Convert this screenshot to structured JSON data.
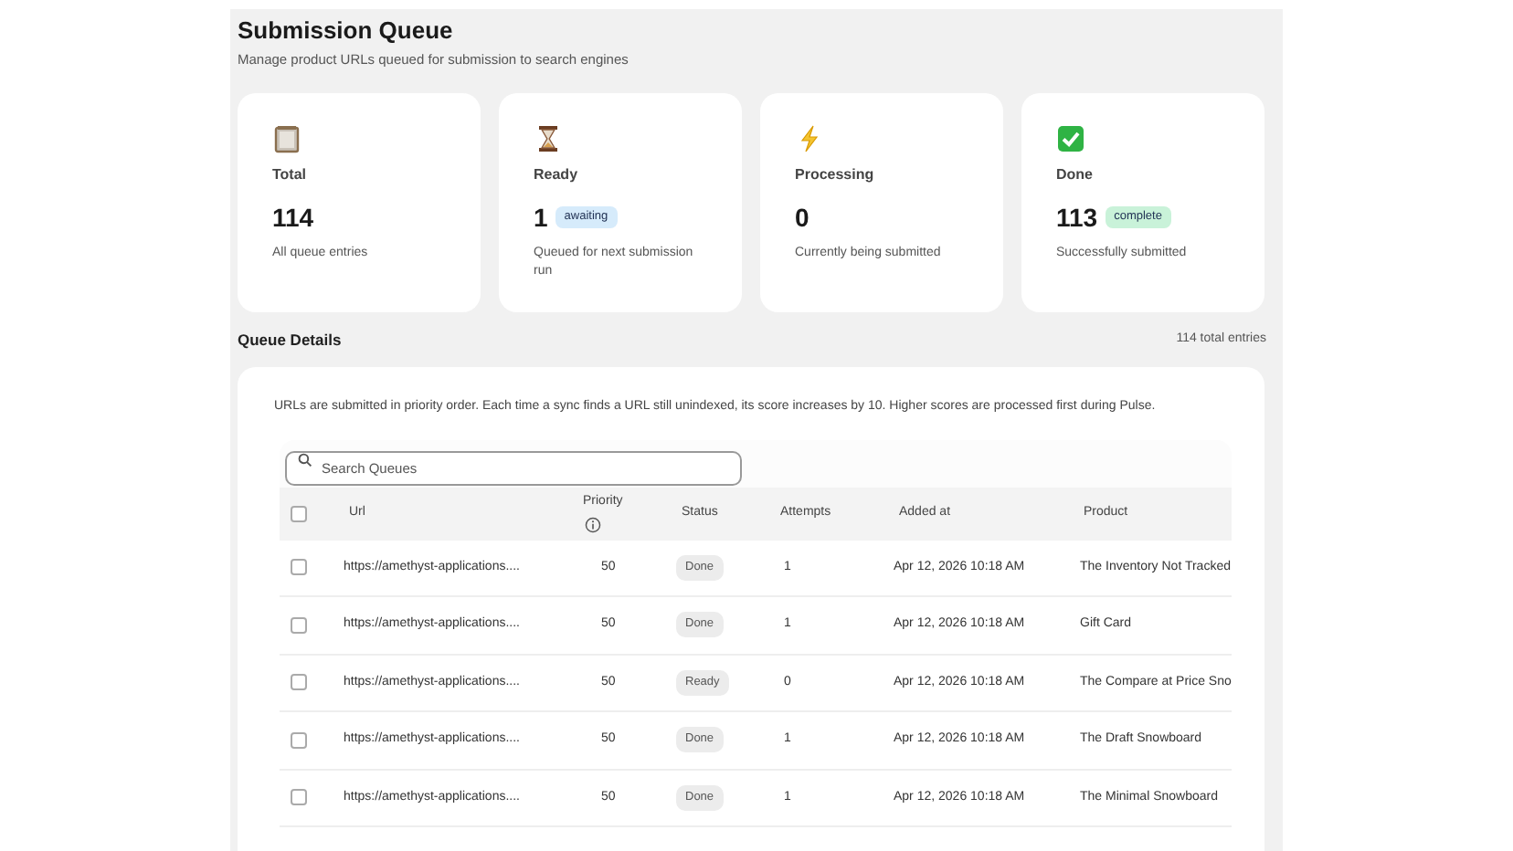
{
  "header": {
    "title": "Submission Queue",
    "subtitle": "Manage product URLs queued for submission to search engines"
  },
  "stats": [
    {
      "kind": "clipboard",
      "label": "Total",
      "value": "114",
      "description": "All queue entries"
    },
    {
      "kind": "hourglass",
      "label": "Ready",
      "value": "1",
      "badge": {
        "text": "awaiting",
        "color": "#d6ebfb"
      },
      "description": "Queued for next submission run"
    },
    {
      "kind": "bolt",
      "label": "Processing",
      "value": "0",
      "description": "Currently being submitted"
    },
    {
      "kind": "check",
      "label": "Done",
      "value": "113",
      "badge": {
        "text": "complete",
        "color": "#c9f2d9"
      },
      "description": "Successfully submitted"
    }
  ],
  "details": {
    "title": "Queue Details",
    "count": "114 total entries",
    "note": "URLs are submitted in priority order. Each time a sync finds a URL still unindexed, its score increases by 10. Higher scores are processed first during Pulse.",
    "search": {
      "placeholder": "Search Queues"
    }
  },
  "table": {
    "select_all": {
      "checked": false
    },
    "columns": [
      "Url",
      "Priority",
      "Status",
      "Attempts",
      "Added at",
      "Product"
    ],
    "rows": [
      {
        "checked": false,
        "url": "https://amethyst-applications....",
        "priority": "50",
        "status": "Done",
        "attempts": "1",
        "added": "Apr 12, 2026 10:18 AM",
        "product": "The Inventory Not Tracked"
      },
      {
        "checked": false,
        "url": "https://amethyst-applications....",
        "priority": "50",
        "status": "Done",
        "attempts": "1",
        "added": "Apr 12, 2026 10:18 AM",
        "product": "Gift Card"
      },
      {
        "checked": false,
        "url": "https://amethyst-applications....",
        "priority": "50",
        "status": "Ready",
        "attempts": "0",
        "added": "Apr 12, 2026 10:18 AM",
        "product": "The Compare at Price Sno"
      },
      {
        "checked": false,
        "url": "https://amethyst-applications....",
        "priority": "50",
        "status": "Done",
        "attempts": "1",
        "added": "Apr 12, 2026 10:18 AM",
        "product": "The Draft Snowboard"
      },
      {
        "checked": false,
        "url": "https://amethyst-applications....",
        "priority": "50",
        "status": "Done",
        "attempts": "1",
        "added": "Apr 12, 2026 10:18 AM",
        "product": "The Minimal Snowboard"
      }
    ]
  }
}
